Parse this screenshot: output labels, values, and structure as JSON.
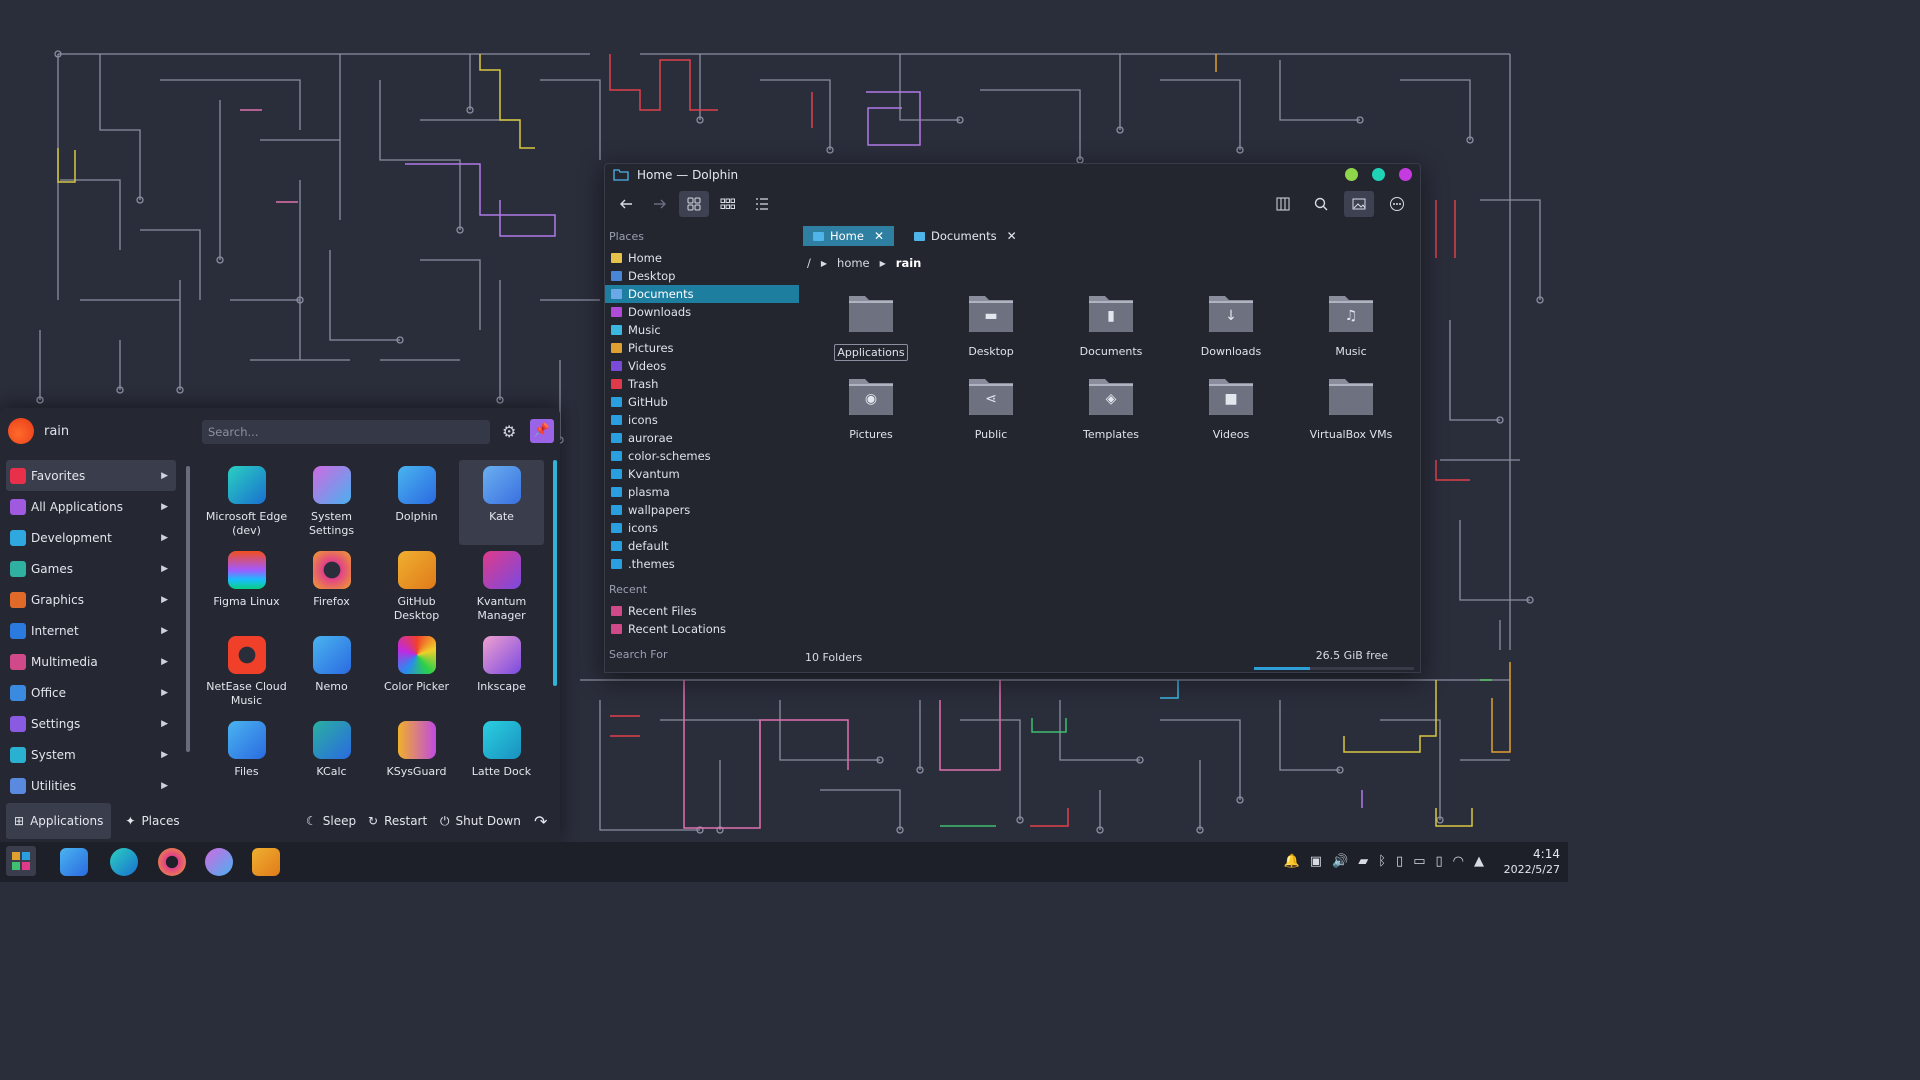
{
  "dolphin": {
    "title": "Home — Dolphin",
    "window_buttons": [
      "#8fd64b",
      "#1fd3b4",
      "#c53be0"
    ],
    "places_header": "Places",
    "places": [
      {
        "label": "Home",
        "icon": "home-icon",
        "color": "#e6c24a"
      },
      {
        "label": "Desktop",
        "icon": "desktop-icon",
        "color": "#4a86d8"
      },
      {
        "label": "Documents",
        "icon": "documents-icon",
        "color": "#6aa8e8",
        "selected": true
      },
      {
        "label": "Downloads",
        "icon": "downloads-icon",
        "color": "#b04ad8"
      },
      {
        "label": "Music",
        "icon": "music-icon",
        "color": "#3ab8e0"
      },
      {
        "label": "Pictures",
        "icon": "pictures-icon",
        "color": "#e0a030"
      },
      {
        "label": "Videos",
        "icon": "videos-icon",
        "color": "#7a4ad8"
      },
      {
        "label": "Trash",
        "icon": "trash-icon",
        "color": "#e03a4a"
      },
      {
        "label": "GitHub",
        "icon": "folder-icon",
        "color": "#2a9fe0"
      },
      {
        "label": "icons",
        "icon": "folder-icon",
        "color": "#2a9fe0"
      },
      {
        "label": "aurorae",
        "icon": "folder-icon",
        "color": "#2a9fe0"
      },
      {
        "label": "color-schemes",
        "icon": "folder-icon",
        "color": "#2a9fe0"
      },
      {
        "label": "Kvantum",
        "icon": "folder-icon",
        "color": "#2a9fe0"
      },
      {
        "label": "plasma",
        "icon": "folder-icon",
        "color": "#2a9fe0"
      },
      {
        "label": "wallpapers",
        "icon": "folder-icon",
        "color": "#2a9fe0"
      },
      {
        "label": "icons",
        "icon": "folder-icon",
        "color": "#2a9fe0"
      },
      {
        "label": "default",
        "icon": "folder-icon",
        "color": "#2a9fe0"
      },
      {
        "label": ".themes",
        "icon": "folder-icon",
        "color": "#2a9fe0"
      }
    ],
    "recent_header": "Recent",
    "recent": [
      {
        "label": "Recent Files",
        "icon": "recent-files-icon",
        "color": "#d04a8a"
      },
      {
        "label": "Recent Locations",
        "icon": "recent-locations-icon",
        "color": "#d04a8a"
      }
    ],
    "search_header": "Search For",
    "tabs": [
      {
        "label": "Home",
        "close": "✕",
        "active": true
      },
      {
        "label": "Documents",
        "close": "✕",
        "active": false
      }
    ],
    "breadcrumb": {
      "root": "/",
      "seg1": "home",
      "current": "rain"
    },
    "folders": [
      {
        "label": "Applications",
        "glyph": "",
        "focus": true
      },
      {
        "label": "Desktop",
        "glyph": "▬"
      },
      {
        "label": "Documents",
        "glyph": "▮"
      },
      {
        "label": "Downloads",
        "glyph": "↓"
      },
      {
        "label": "Music",
        "glyph": "♫"
      },
      {
        "label": "Pictures",
        "glyph": "◉"
      },
      {
        "label": "Public",
        "glyph": "⋖"
      },
      {
        "label": "Templates",
        "glyph": "◈"
      },
      {
        "label": "Videos",
        "glyph": "■"
      },
      {
        "label": "VirtualBox VMs",
        "glyph": ""
      }
    ],
    "status_count": "10 Folders",
    "free_space": "26.5 GiB free",
    "free_fraction": 0.35
  },
  "launcher": {
    "user": "rain",
    "search_placeholder": "Search...",
    "categories": [
      {
        "label": "Favorites",
        "color": "#e8304a",
        "selected": true
      },
      {
        "label": "All Applications",
        "color": "#a05ae0"
      },
      {
        "label": "Development",
        "color": "#2fa8e0"
      },
      {
        "label": "Games",
        "color": "#2fb0a0"
      },
      {
        "label": "Graphics",
        "color": "#e06a2a"
      },
      {
        "label": "Internet",
        "color": "#2a7ae0"
      },
      {
        "label": "Multimedia",
        "color": "#d04a8a"
      },
      {
        "label": "Office",
        "color": "#3a8ae0"
      },
      {
        "label": "Settings",
        "color": "#8a5ae0"
      },
      {
        "label": "System",
        "color": "#2ab0d0"
      },
      {
        "label": "Utilities",
        "color": "#5a8ae0"
      }
    ],
    "apps": [
      {
        "label": "Microsoft Edge (dev)",
        "icon": "edge-icon",
        "bg": "linear-gradient(135deg,#2ad0c0,#1a70d0)"
      },
      {
        "label": "System Settings",
        "icon": "settings-icon",
        "bg": "linear-gradient(135deg,#d06ae0,#4ab0f0)"
      },
      {
        "label": "Dolphin",
        "icon": "dolphin-icon",
        "bg": "linear-gradient(135deg,#4ab4f0,#2a6ae0)"
      },
      {
        "label": "Kate",
        "icon": "kate-icon",
        "bg": "linear-gradient(135deg,#6ab0f0,#3a70e0)",
        "selected": true
      },
      {
        "label": "Figma Linux",
        "icon": "figma-icon",
        "bg": "linear-gradient(180deg,#f24e1e,#a259ff 50%,#1abcfe 75%,#0acf83)"
      },
      {
        "label": "Firefox",
        "icon": "firefox-icon",
        "bg": "radial-gradient(circle,#2a2d3a 30%,#e0408a 32%,#f0a02a)"
      },
      {
        "label": "GitHub Desktop",
        "icon": "github-desktop-icon",
        "bg": "linear-gradient(135deg,#f0b030,#e07a1a)"
      },
      {
        "label": "Kvantum Manager",
        "icon": "kvantum-icon",
        "bg": "linear-gradient(135deg,#e03a8a,#7a4ae0)"
      },
      {
        "label": "NetEase Cloud Music",
        "icon": "netease-icon",
        "bg": "radial-gradient(circle,#2a2d3a 30%,#f0402a 32%)"
      },
      {
        "label": "Nemo",
        "icon": "nemo-icon",
        "bg": "linear-gradient(135deg,#4ab4f0,#2a6ae0)"
      },
      {
        "label": "Color Picker",
        "icon": "color-picker-icon",
        "bg": "conic-gradient(#f0402a,#f0d02a,#2ad04a,#2a8af0,#c02ae0,#f0402a)"
      },
      {
        "label": "Inkscape",
        "icon": "inkscape-icon",
        "bg": "linear-gradient(135deg,#f0a0d0,#7a4ae0)"
      },
      {
        "label": "Files",
        "icon": "files-icon",
        "bg": "linear-gradient(135deg,#4ab4f0,#2a6ae0)"
      },
      {
        "label": "KCalc",
        "icon": "kcalc-icon",
        "bg": "linear-gradient(135deg,#2ab0a0,#2a6ae0)"
      },
      {
        "label": "KSysGuard",
        "icon": "ksysguard-icon",
        "bg": "linear-gradient(90deg,#f0b02a,#c04ae0)"
      },
      {
        "label": "Latte Dock",
        "icon": "latte-dock-icon",
        "bg": "linear-gradient(135deg,#2ad0e0,#1a90c0)"
      }
    ],
    "footer": {
      "applications": "Applications",
      "places": "Places",
      "sleep": "Sleep",
      "restart": "Restart",
      "shutdown": "Shut Down"
    }
  },
  "taskbar": {
    "time": "4:14",
    "date": "2022/5/27"
  }
}
